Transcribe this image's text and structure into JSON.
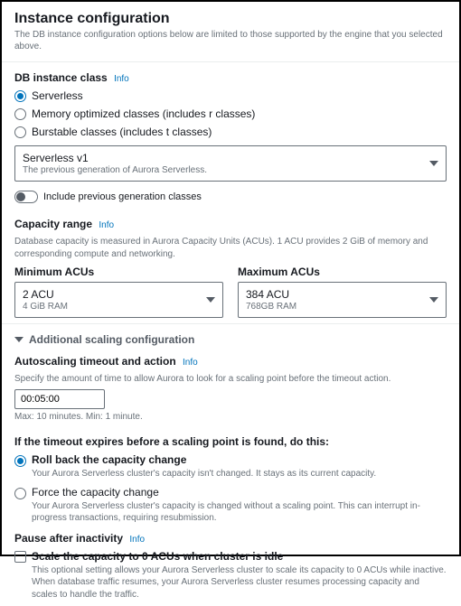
{
  "header": {
    "title": "Instance configuration",
    "subtitle": "The DB instance configuration options below are limited to those supported by the engine that you selected above."
  },
  "instance_class": {
    "label": "DB instance class",
    "info": "Info",
    "options": {
      "serverless": "Serverless",
      "memory": "Memory optimized classes (includes r classes)",
      "burstable": "Burstable classes (includes t classes)"
    },
    "generation_select": {
      "value": "Serverless v1",
      "hint": "The previous generation of Aurora Serverless."
    },
    "include_previous": "Include previous generation classes"
  },
  "capacity": {
    "label": "Capacity range",
    "info": "Info",
    "desc": "Database capacity is measured in Aurora Capacity Units (ACUs). 1 ACU provides 2 GiB of memory and corresponding compute and networking.",
    "min": {
      "label": "Minimum ACUs",
      "value": "2 ACU",
      "hint": "4 GiB RAM"
    },
    "max": {
      "label": "Maximum ACUs",
      "value": "384 ACU",
      "hint": "768GB RAM"
    }
  },
  "scaling": {
    "expand_label": "Additional scaling configuration",
    "auto": {
      "label": "Autoscaling timeout and action",
      "info": "Info",
      "desc": "Specify the amount of time to allow Aurora to look for a scaling point before the timeout action.",
      "value": "00:05:00",
      "hint": "Max: 10 minutes. Min: 1 minute."
    },
    "timeout": {
      "heading": "If the timeout expires before a scaling point is found, do this:",
      "rollback": {
        "label": "Roll back the capacity change",
        "desc": "Your Aurora Serverless cluster's capacity isn't changed. It stays as its current capacity."
      },
      "force": {
        "label": "Force the capacity change",
        "desc": "Your Aurora Serverless cluster's capacity is changed without a scaling point. This can interrupt in-progress transactions, requiring resubmission."
      }
    },
    "pause": {
      "label": "Pause after inactivity",
      "info": "Info",
      "check_label": "Scale the capacity to 0 ACUs when cluster is idle",
      "desc": "This optional setting allows your Aurora Serverless cluster to scale its capacity to 0 ACUs while inactive. When database traffic resumes, your Aurora Serverless cluster resumes processing capacity and scales to handle the traffic."
    }
  }
}
